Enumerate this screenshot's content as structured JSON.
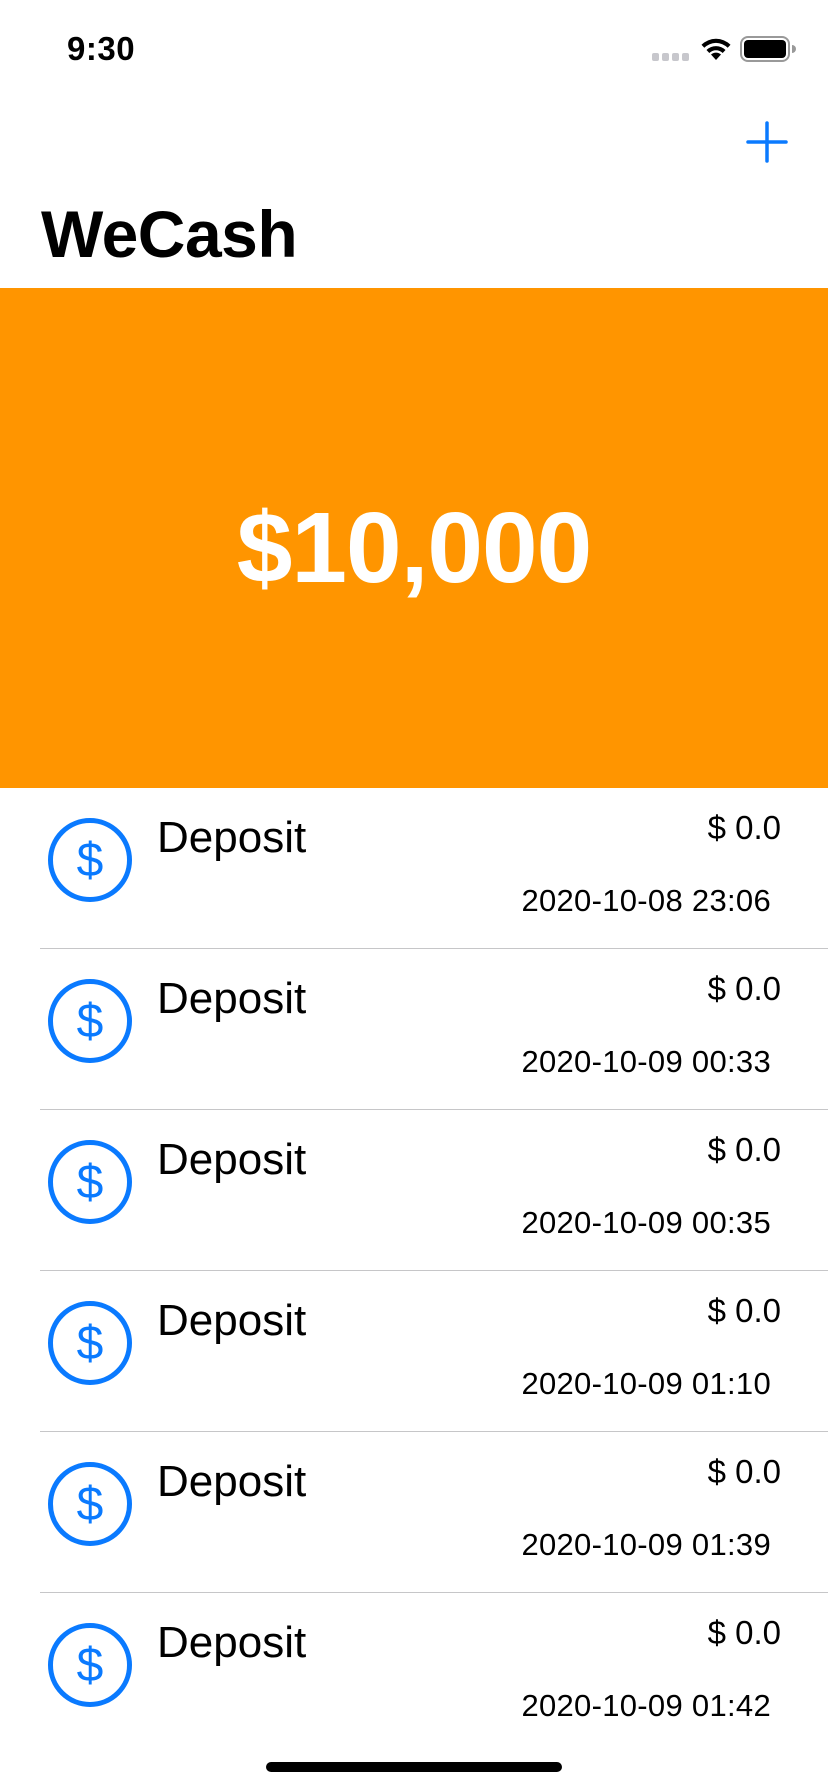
{
  "status_bar": {
    "time": "9:30"
  },
  "nav": {
    "add_icon": "plus-icon",
    "title": "WeCash"
  },
  "balance": {
    "amount": "$10,000",
    "card_color": "#ff9500"
  },
  "accent_color": "#0a7aff",
  "transactions": [
    {
      "title": "Deposit",
      "amount": "$ 0.0",
      "date": "2020-10-08 23:06",
      "icon": "dollar-circle-icon"
    },
    {
      "title": "Deposit",
      "amount": "$ 0.0",
      "date": "2020-10-09 00:33",
      "icon": "dollar-circle-icon"
    },
    {
      "title": "Deposit",
      "amount": "$ 0.0",
      "date": "2020-10-09 00:35",
      "icon": "dollar-circle-icon"
    },
    {
      "title": "Deposit",
      "amount": "$ 0.0",
      "date": "2020-10-09 01:10",
      "icon": "dollar-circle-icon"
    },
    {
      "title": "Deposit",
      "amount": "$ 0.0",
      "date": "2020-10-09 01:39",
      "icon": "dollar-circle-icon"
    },
    {
      "title": "Deposit",
      "amount": "$ 0.0",
      "date": "2020-10-09 01:42",
      "icon": "dollar-circle-icon"
    }
  ]
}
